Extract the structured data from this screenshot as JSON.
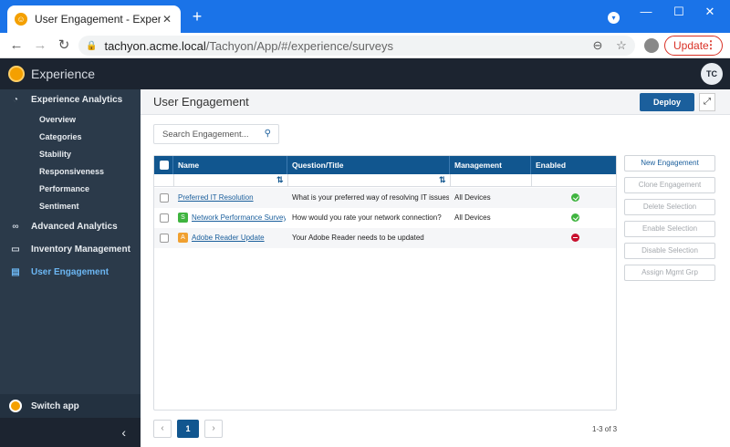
{
  "browser": {
    "tab_title": "User Engagement - Experience",
    "new_tab": "+",
    "url_host": "tachyon.acme.local",
    "url_path": "/Tachyon/App/#/experience/surveys",
    "update_label": "Update",
    "window_controls": [
      "minimize",
      "maximize",
      "close"
    ]
  },
  "app": {
    "name": "Experience",
    "user_initials": "TC"
  },
  "sidebar": {
    "sections": [
      {
        "label": "Experience Analytics",
        "icon": "dashboard-icon",
        "active": false
      },
      {
        "label": "Advanced Analytics",
        "icon": "binoculars-icon",
        "active": false
      },
      {
        "label": "Inventory Management",
        "icon": "monitor-icon",
        "active": false
      },
      {
        "label": "User Engagement",
        "icon": "clipboard-icon",
        "active": true
      }
    ],
    "sub_items": [
      "Overview",
      "Categories",
      "Stability",
      "Responsiveness",
      "Performance",
      "Sentiment"
    ],
    "switch_app": "Switch app",
    "collapse": "‹"
  },
  "page": {
    "title": "User Engagement",
    "deploy_label": "Deploy",
    "expand_icon": "⤢"
  },
  "search": {
    "placeholder": "Search Engagement..."
  },
  "table": {
    "columns": [
      "Name",
      "Question/Title",
      "Management Groups",
      "Enabled"
    ],
    "rows": [
      {
        "badge": "",
        "badge_color": "",
        "name": "Preferred IT Resolution",
        "question": "What is your preferred way of resolving IT issues?",
        "groups": "All Devices",
        "enabled": true
      },
      {
        "badge": "S",
        "badge_color": "#3fb43f",
        "name": "Network Performance Survey",
        "question": "How would you rate your network connection?",
        "groups": "All Devices",
        "enabled": true
      },
      {
        "badge": "A",
        "badge_color": "#f0a030",
        "name": "Adobe Reader Update",
        "question": "Your Adobe Reader needs to be updated",
        "groups": "",
        "enabled": false
      }
    ]
  },
  "actions": [
    {
      "label": "New Engagement",
      "enabled": true
    },
    {
      "label": "Clone Engagement",
      "enabled": false
    },
    {
      "label": "Delete Selection",
      "enabled": false
    },
    {
      "label": "Enable Selection",
      "enabled": false
    },
    {
      "label": "Disable Selection",
      "enabled": false
    },
    {
      "label": "Assign Mgmt Grp",
      "enabled": false
    }
  ],
  "pagination": {
    "prev": "‹",
    "current": "1",
    "next": "›",
    "count": "1-3 of 3"
  }
}
